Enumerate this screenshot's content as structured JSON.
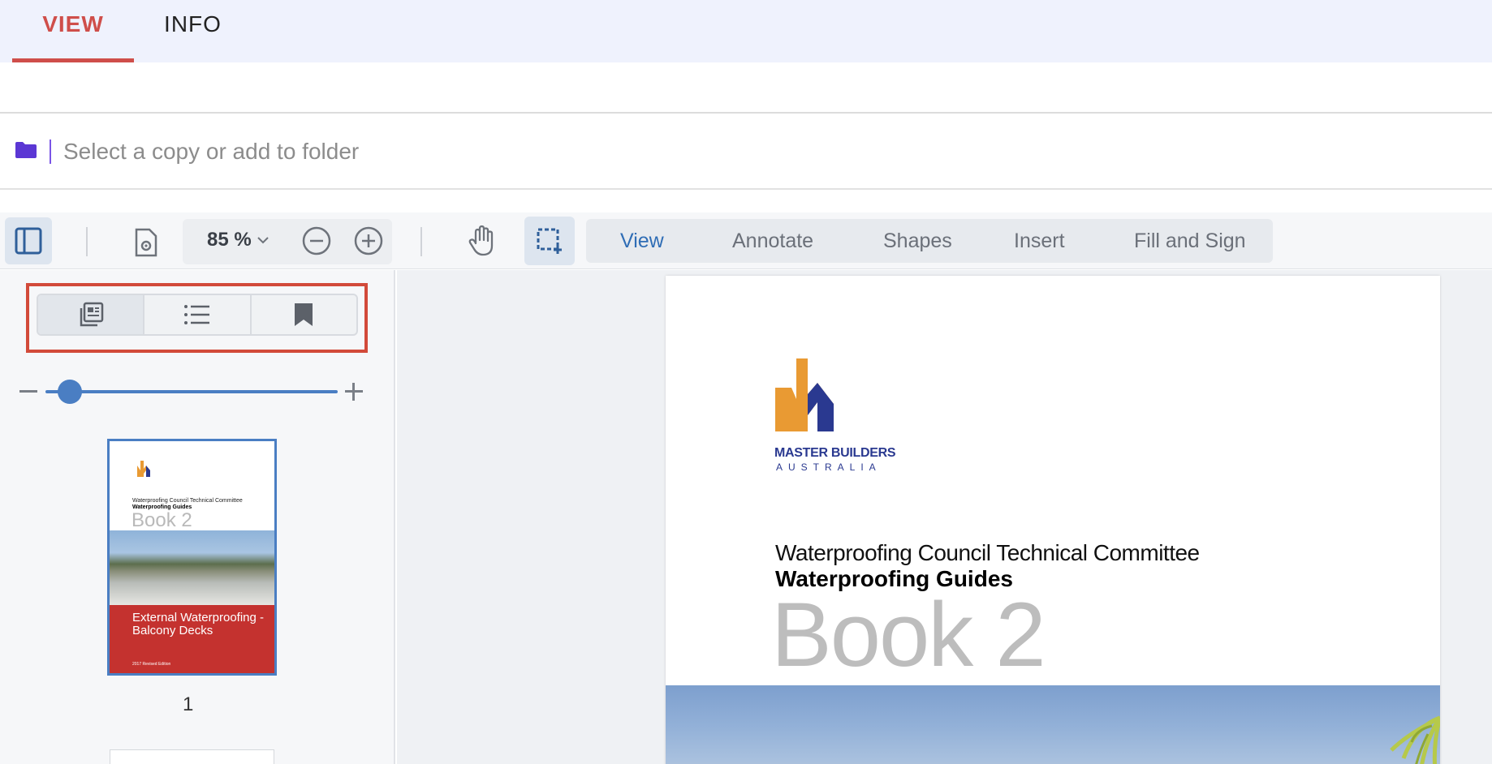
{
  "top_tabs": [
    {
      "label": "VIEW",
      "active": true
    },
    {
      "label": "INFO",
      "active": false
    }
  ],
  "folder_bar": {
    "icon": "folder-icon",
    "placeholder": "Select a copy or add to folder",
    "value": ""
  },
  "toolbar": {
    "zoom_value": "85 %",
    "mode_tabs": [
      {
        "label": "View",
        "active": true
      },
      {
        "label": "Annotate",
        "active": false
      },
      {
        "label": "Shapes",
        "active": false
      },
      {
        "label": "Insert",
        "active": false
      },
      {
        "label": "Fill and Sign",
        "active": false
      }
    ]
  },
  "left_panel": {
    "segments": [
      {
        "icon": "thumbnails-icon",
        "active": true
      },
      {
        "icon": "outline-list-icon",
        "active": false
      },
      {
        "icon": "bookmark-icon",
        "active": false
      }
    ],
    "thumbnail": {
      "page_number": "1",
      "committee": "Waterproofing Council Technical Committee",
      "guides": "Waterproofing Guides",
      "book": "Book 2",
      "cover_title": "External Waterproofing - Balcony Decks",
      "edition": "2017 Revised Edition"
    }
  },
  "document": {
    "logo_name": "MASTER BUILDERS",
    "logo_sub": "AUSTRALIA",
    "line1": "Waterproofing Council Technical Committee",
    "line2": "Waterproofing Guides",
    "book": "Book 2"
  },
  "colors": {
    "accent_red": "#cf4e4a",
    "highlight_red": "#d24a3a",
    "accent_blue": "#4a7ec3",
    "folder_purple": "#5b37d4",
    "logo_orange": "#e99a33",
    "logo_navy": "#2a3990"
  }
}
